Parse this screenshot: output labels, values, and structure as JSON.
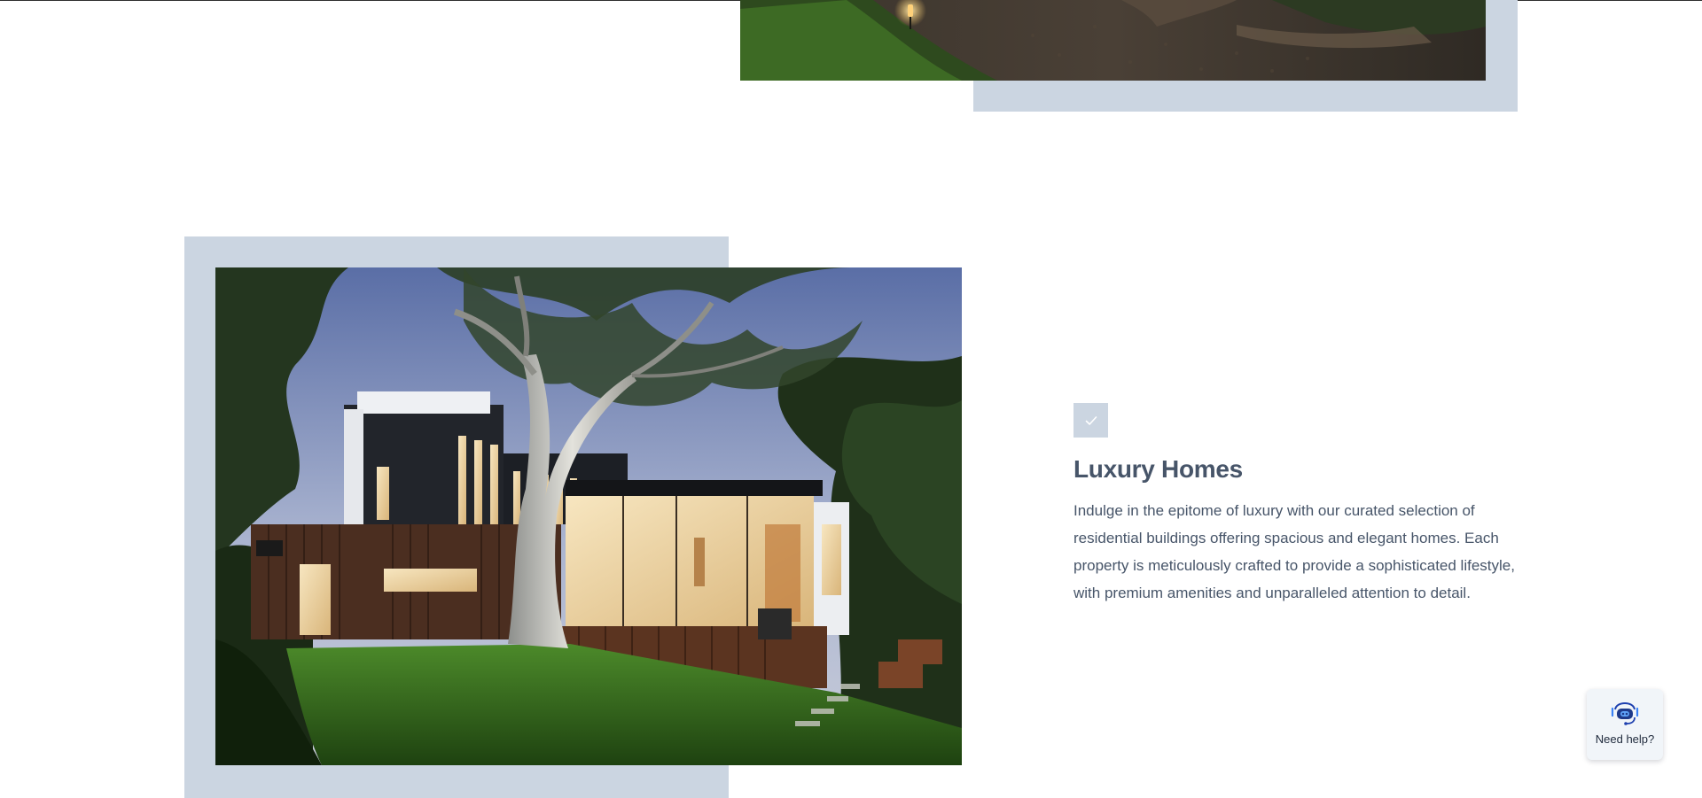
{
  "feature": {
    "icon": "check-icon",
    "title": "Luxury Homes",
    "description": "Indulge in the epitome of luxury with our curated selection of residential buildings offering spacious and elegant homes. Each property is meticulously crafted to provide a sophisticated lifestyle, with premium amenities and unparalleled attention to detail."
  },
  "help_widget": {
    "icon": "support-bot-icon",
    "label": "Need help?"
  },
  "colors": {
    "frame": "#cbd5e1",
    "text": "#475569",
    "accent": "#1e40af"
  }
}
